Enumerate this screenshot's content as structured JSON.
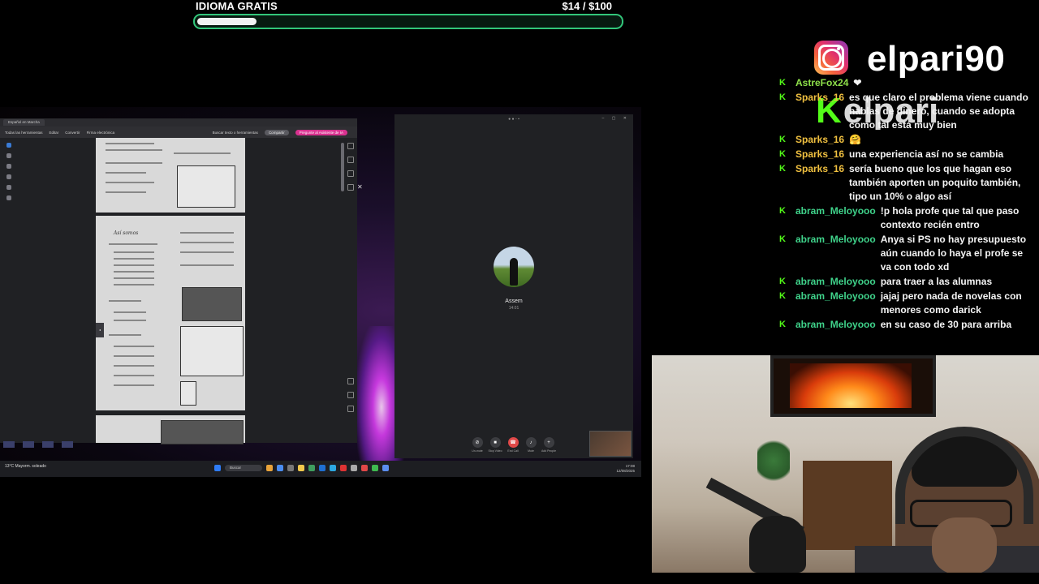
{
  "goal": {
    "title": "IDIOMA GRATIS",
    "amount": "$14",
    "target": "/ $100",
    "progress": 0.14
  },
  "document_viewer": {
    "tab": "Español en Marcha",
    "toolbar": [
      "Todas las herramientas",
      "Editar",
      "Convertir",
      "Firma electrónica"
    ],
    "search": "Buscar texto o herramientas",
    "share_button": "Compartir",
    "ai_button": "Pregunte al Asistente de IA",
    "unit_heading": "Así somos"
  },
  "call": {
    "callee": "Assem",
    "duration": "14:01",
    "controls": [
      "Un-mute",
      "Stop Video",
      "End Call",
      "Mute",
      "Add People"
    ]
  },
  "taskbar": {
    "weather": "13°C Mayorm. soleado",
    "search": "Buscar",
    "time": "17:08",
    "date": "12/08/2025"
  },
  "instagram": {
    "handle": "elpari90",
    "icon": "instagram-icon"
  },
  "watermark": "elpari",
  "chat": [
    {
      "user": "AstreFox24",
      "color": "#8ee04a",
      "badge": "kick-badge",
      "text": "❤"
    },
    {
      "user": "Sparks_16",
      "color": "#f0c040",
      "badge": "kick-badge",
      "text": "es que claro el problema viene cuando hablas de dinero, cuando se adopta como tal está muy bien"
    },
    {
      "user": "Sparks_16",
      "color": "#f0c040",
      "badge": "kick-badge",
      "text": "🤗"
    },
    {
      "user": "Sparks_16",
      "color": "#f0c040",
      "badge": "kick-badge",
      "text": "una experiencia así no se cambia"
    },
    {
      "user": "Sparks_16",
      "color": "#f0c040",
      "badge": "kick-badge",
      "text": "sería bueno que los que hagan eso también aporten un poquito también, tipo un 10% o algo así"
    },
    {
      "user": "abram_Meloyooo",
      "color": "#3fd28a",
      "badge": "kick-badge",
      "text": "!p hola profe que tal que paso contexto recién entro"
    },
    {
      "user": "abram_Meloyooo",
      "color": "#3fd28a",
      "badge": "kick-badge",
      "text": "Anya si PS no hay presupuesto aún cuando lo haya el profe se va con todo xd"
    },
    {
      "user": "abram_Meloyooo",
      "color": "#3fd28a",
      "badge": "kick-badge",
      "text": "para traer a las alumnas"
    },
    {
      "user": "abram_Meloyooo",
      "color": "#3fd28a",
      "badge": "kick-badge",
      "text": "jajaj pero nada de novelas con menores como darick"
    },
    {
      "user": "abram_Meloyooo",
      "color": "#3fd28a",
      "badge": "kick-badge",
      "text": "en su caso de 30 para arriba"
    }
  ]
}
